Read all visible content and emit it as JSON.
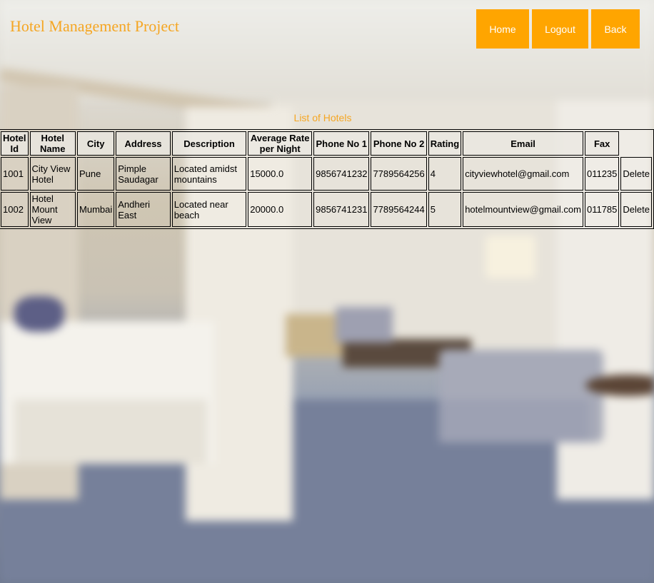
{
  "header": {
    "brand": "Hotel Management Project",
    "nav": {
      "home": "Home",
      "logout": "Logout",
      "back": "Back"
    }
  },
  "caption": "List of Hotels",
  "columns": [
    "Hotel Id",
    "Hotel Name",
    "City",
    "Address",
    "Description",
    "Average Rate per Night",
    "Phone No 1",
    "Phone No 2",
    "Rating",
    "Email",
    "Fax"
  ],
  "rows": [
    {
      "id": "1001",
      "name": "City View Hotel",
      "city": "Pune",
      "address": "Pimple Saudagar",
      "description": "Located amidst mountains",
      "rate": "15000.0",
      "phone1": "9856741232",
      "phone2": "7789564256",
      "rating": "4",
      "email": "cityviewhotel@gmail.com",
      "fax": "011235",
      "action": "Delete"
    },
    {
      "id": "1002",
      "name": "Hotel Mount View",
      "city": "Mumbai",
      "address": "Andheri East",
      "description": "Located near beach",
      "rate": "20000.0",
      "phone1": "9856741231",
      "phone2": "7789564244",
      "rating": "5",
      "email": "hotelmountview@gmail.com",
      "fax": "011785",
      "action": "Delete"
    }
  ],
  "colors": {
    "accent": "#ffa500",
    "brand_text": "#f5a623"
  }
}
